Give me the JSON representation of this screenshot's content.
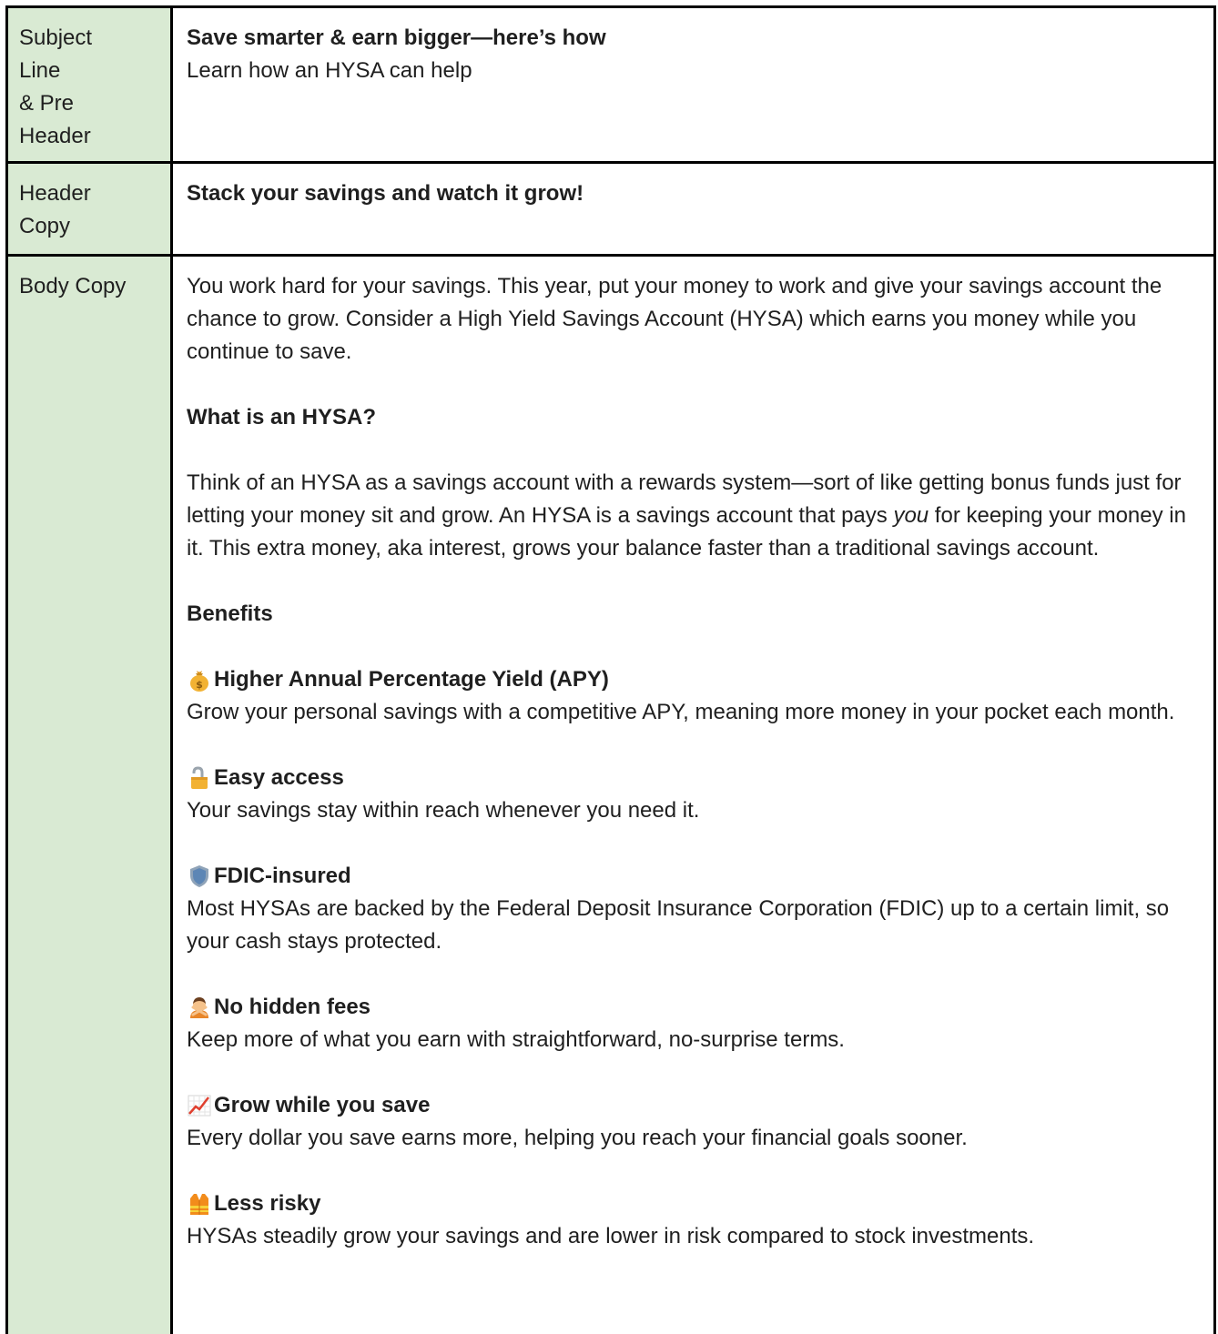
{
  "rows": {
    "subject": {
      "label": "Subject Line & Pre Header",
      "label_lines": [
        "Subject",
        "Line",
        "& Pre",
        "Header"
      ],
      "subject_line": "Save smarter & earn bigger—here’s how",
      "pre_header": "Learn how an HYSA can help"
    },
    "header": {
      "label_lines": [
        "Header",
        "Copy"
      ],
      "copy": "Stack your savings and watch it grow!"
    },
    "body": {
      "label": "Body Copy",
      "intro": "You work hard for your savings. This year, put your money to work and give your savings account the chance to grow. Consider a High Yield Savings Account (HYSA) which earns you money while you continue to save.",
      "what_heading": "What is an HYSA?",
      "what_text_1": "Think of an HYSA as a savings account with a rewards system—sort of like getting bonus funds just for letting your money sit and grow. An HYSA is a savings account that pays ",
      "what_text_em": "you",
      "what_text_2": " for keeping your money in it. This extra money, aka interest, grows your balance faster than a traditional savings account.",
      "benefits_heading": "Benefits",
      "benefits": [
        {
          "icon": "money-bag-icon",
          "title": "Higher Annual Percentage Yield (APY)",
          "text": "Grow your personal savings with a competitive APY, meaning more money in your pocket each month."
        },
        {
          "icon": "unlocked-icon",
          "title": "Easy access",
          "text": "Your savings stay within reach whenever you need it."
        },
        {
          "icon": "shield-icon",
          "title": "FDIC-insured",
          "text": "Most HYSAs are backed by the Federal Deposit Insurance Corporation (FDIC) up to a certain limit, so your cash stays protected."
        },
        {
          "icon": "person-gesturing-no-icon",
          "title": "No hidden fees",
          "text": "Keep more of what you earn with straightforward, no-surprise terms."
        },
        {
          "icon": "chart-increasing-icon",
          "title": "Grow while you save",
          "text": "Every dollar you save earns more, helping you reach your financial goals sooner."
        },
        {
          "icon": "safety-vest-icon",
          "title": "Less risky",
          "text": "HYSAs steadily grow your savings and are lower in risk compared to stock investments."
        }
      ]
    }
  },
  "colors": {
    "label_bg": "#d9ead3",
    "border": "#000000",
    "text": "#1f1f1f"
  }
}
